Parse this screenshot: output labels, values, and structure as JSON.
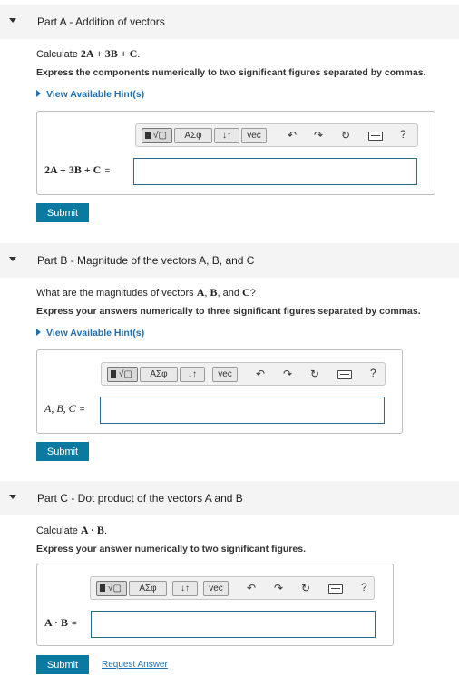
{
  "partA": {
    "header_prefix": "Part A",
    "header_title": " - Addition of vectors",
    "question_prefix": "Calculate ",
    "question_math": "2A + 3B + C",
    "question_suffix": ".",
    "instruction": "Express the components numerically to two significant figures separated by commas.",
    "hint": "View Available Hint(s)",
    "label": "2A + 3B + C",
    "equals": "=",
    "value": "",
    "submit": "Submit"
  },
  "partB": {
    "header_prefix": "Part B",
    "header_title": " - Magnitude of the vectors A, B, and C",
    "question_prefix": "What are the magnitudes of vectors ",
    "question_math1": "A",
    "question_sep1": ", ",
    "question_math2": "B",
    "question_sep2": ", and ",
    "question_math3": "C",
    "question_suffix": "?",
    "instruction": "Express your answers numerically to three significant figures separated by commas.",
    "hint": "View Available Hint(s)",
    "label": "A, B, C",
    "equals": "=",
    "value": "",
    "submit": "Submit"
  },
  "partC": {
    "header_prefix": "Part C",
    "header_title": " - Dot product of the vectors A and B",
    "question_prefix": "Calculate ",
    "question_math": "A · B",
    "question_suffix": ".",
    "instruction": "Express your answer numerically to two significant figures.",
    "label": "A · B",
    "equals": "=",
    "value": "",
    "submit": "Submit",
    "request_answer": "Request Answer"
  },
  "toolbar": {
    "sqrt_glyph": "√▢",
    "greek": "ΑΣφ",
    "arrows": "↓↑",
    "vec": "vec",
    "undo": "↶",
    "redo": "↷",
    "reset": "↻",
    "help": "?"
  },
  "colors": {
    "accent": "#0b7aa0",
    "link": "#1f6fb0",
    "field_border": "#2b6a8f"
  }
}
